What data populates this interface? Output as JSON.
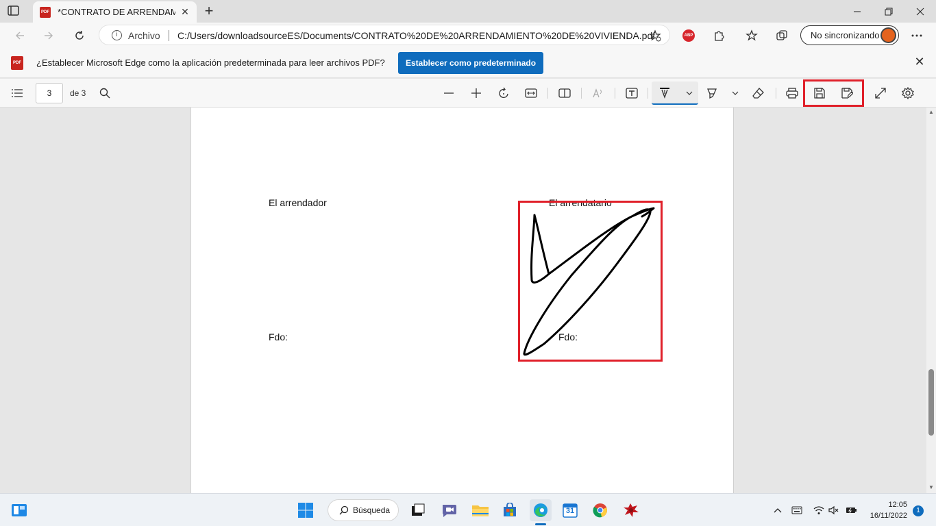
{
  "browser": {
    "tab": {
      "title": "*CONTRATO DE ARRENDAMIENTO",
      "favicon_label": "PDF"
    },
    "new_tab_icon": "plus-icon",
    "address_bar": {
      "security_label": "Archivo",
      "url": "C:/Users/downloadsourceES/Documents/CONTRATO%20DE%20ARRENDAMIENTO%20DE%20VIVIENDA.pdf"
    },
    "extension_abp_label": "ABP",
    "profile_button": {
      "label": "No sincronizando"
    }
  },
  "infobar": {
    "icon_label": "PDF",
    "message": "¿Establecer Microsoft Edge como la aplicación predeterminada para leer archivos PDF?",
    "button_label": "Establecer como predeterminado"
  },
  "pdf_toolbar": {
    "page_number": "3",
    "page_of": "de 3",
    "highlight_color": "#e0202a"
  },
  "document": {
    "lessor_label": "El arrendador",
    "lessee_label": "El arrendatario",
    "lessor_sign_label": "Fdo:",
    "lessee_sign_label": "Fdo:"
  },
  "taskbar": {
    "search_label": "Búsqueda",
    "calendar_day": "31",
    "time": "12:05",
    "date": "16/11/2022",
    "notification_count": "1"
  },
  "colors": {
    "accent": "#0f6cbd",
    "highlight_red": "#e0202a",
    "pdf_red": "#c8251f"
  }
}
